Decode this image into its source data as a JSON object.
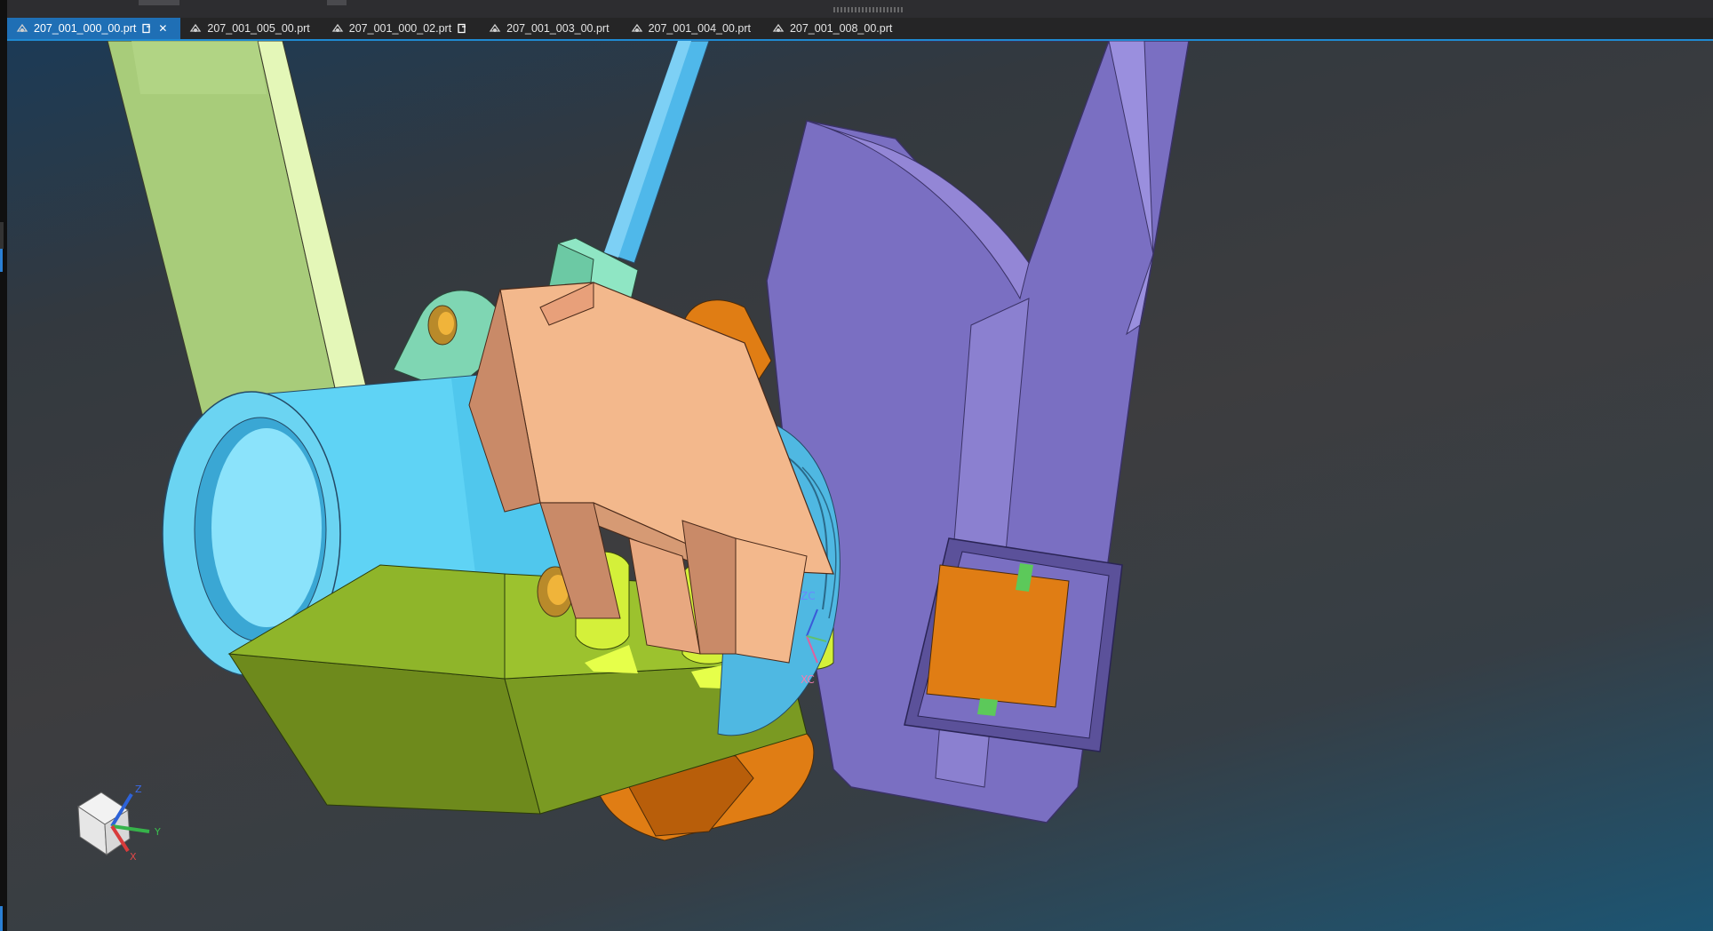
{
  "tabs": [
    {
      "label": "207_001_000_00.prt",
      "active": true,
      "modified": true,
      "closable": true
    },
    {
      "label": "207_001_005_00.prt",
      "active": false,
      "modified": false,
      "closable": false
    },
    {
      "label": "207_001_000_02.prt",
      "active": false,
      "modified": true,
      "closable": false
    },
    {
      "label": "207_001_003_00.prt",
      "active": false,
      "modified": false,
      "closable": false
    },
    {
      "label": "207_001_004_00.prt",
      "active": false,
      "modified": false,
      "closable": false
    },
    {
      "label": "207_001_008_00.prt",
      "active": false,
      "modified": false,
      "closable": false
    }
  ],
  "icons": {
    "tab_part": "part-file-icon",
    "tab_modified": "save-pending-icon",
    "tab_close": "close-icon"
  },
  "wcs": {
    "zc_label": "ZC",
    "xc_label": "XC"
  },
  "view_triad": {
    "z_label": "Z",
    "y_label": "Y",
    "x_label": "X"
  },
  "colors": {
    "accent": "#1f8ad2",
    "active_tab": "#1f6fb5",
    "tube_blue": "#5fd3f5",
    "bracket_purple": "#7a6fc2",
    "clamp_peach": "#f3b88c",
    "base_green": "#8fb52a",
    "knob_orange": "#e07d14",
    "arm_lightgreen": "#c7e59a",
    "rod_blue": "#4fb8ea",
    "mount_mint": "#8fe6c4",
    "axis_z": "#2d62d8",
    "axis_y": "#36b34a",
    "axis_x": "#d83b3b"
  }
}
